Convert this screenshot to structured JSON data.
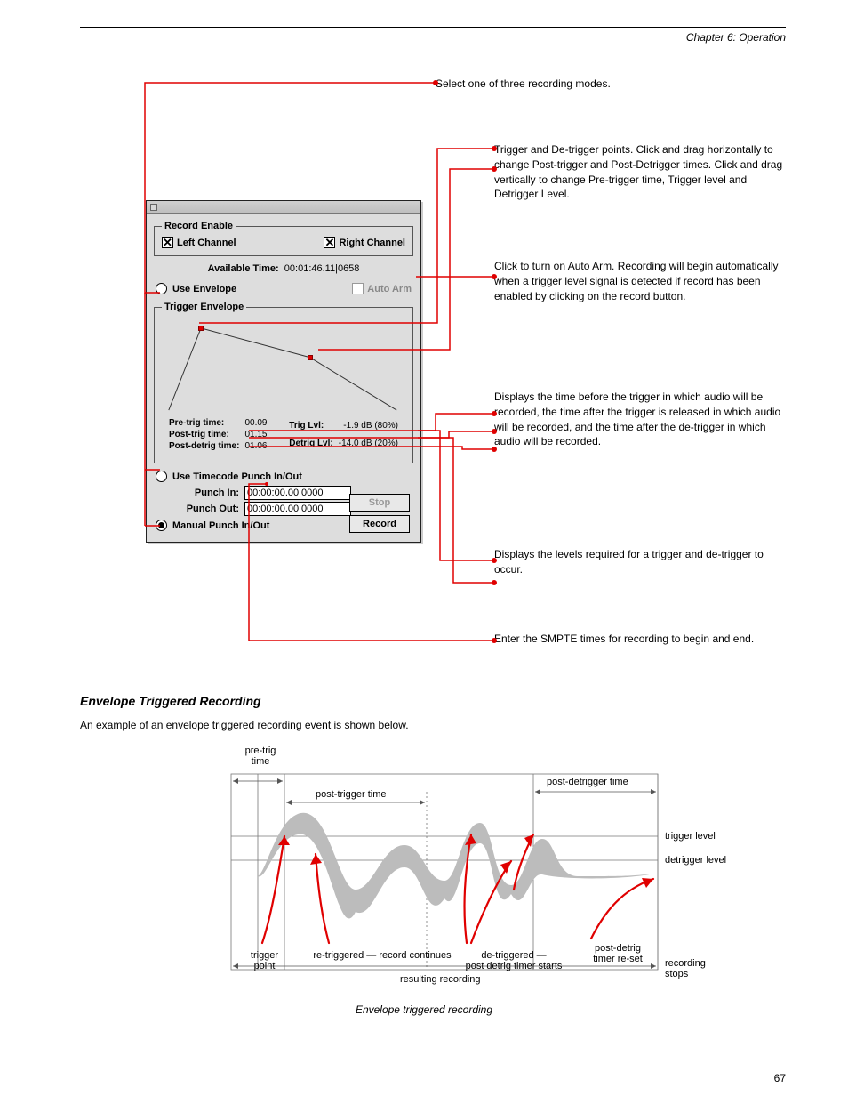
{
  "header": {
    "right": "Chapter 6: Operation"
  },
  "annotations": {
    "a1": "Select one of three recording modes.",
    "a2": "Trigger and De-trigger points. Click and drag horizontally to change Post-trigger and Post-Detrigger times. Click and drag vertically to change Pre-trigger time, Trigger level and Detrigger Level.",
    "a3": "Click to turn on Auto Arm. Recording will begin automatically when a trigger level signal is detected if record has been enabled by clicking on the record button.",
    "a4": "Displays the time before the trigger in which audio will be recorded, the time after the trigger is released in which audio will be recorded, and the time after the de-trigger in which audio will be recorded.",
    "a5": "Displays the levels required for a trigger and de-trigger to occur.",
    "a6": "Enter the SMPTE times for recording to begin and end."
  },
  "dialog": {
    "recordEnable": {
      "legend": "Record Enable",
      "left": {
        "label": "Left Channel",
        "checked": true
      },
      "right": {
        "label": "Right Channel",
        "checked": true
      }
    },
    "availableTimeLabel": "Available Time:",
    "availableTimeValue": "00:01:46.11|0658",
    "useEnvelope": "Use Envelope",
    "autoArm": "Auto Arm",
    "triggerEnvelope": {
      "legend": "Trigger Envelope",
      "preTrigLabel": "Pre-trig time:",
      "preTrigVal": "00.09",
      "postTrigLabel": "Post-trig time:",
      "postTrigVal": "01.15",
      "postDetrigLabel": "Post-detrig time:",
      "postDetrigVal": "01.06",
      "trigLvlLabel": "Trig Lvl:",
      "trigLvlVal": "-1.9 dB (80%)",
      "detrigLvlLabel": "Detrig Lvl:",
      "detrigLvlVal": "-14.0 dB (20%)"
    },
    "useTimecode": "Use Timecode Punch In/Out",
    "punchInLabel": "Punch In:",
    "punchInVal": "00:00:00.00|0000",
    "punchOutLabel": "Punch Out:",
    "punchOutVal": "00:00:00.00|0000",
    "manual": "Manual Punch In/Out",
    "stop": "Stop",
    "record": "Record"
  },
  "sectionTitle": "Envelope Triggered Recording",
  "bodyText": "An example of an envelope triggered recording event is shown below.",
  "diagram": {
    "preTrig": "pre-trig\ntime",
    "postTrig": "post-trigger time",
    "postDetrig": "post-detrigger time",
    "trigLvl": "trigger level",
    "detrigLvl": "detrigger level",
    "trigPoint": "trigger\npoint",
    "retrig": "re-triggered — record continues",
    "detrig": "de-triggered —\npost detrig timer starts",
    "recResult": "resulting recording",
    "recStop": "recording\nstops",
    "timerReset": "post-detrig\ntimer re-set"
  },
  "caption": "Envelope triggered recording",
  "pageNum": "67"
}
